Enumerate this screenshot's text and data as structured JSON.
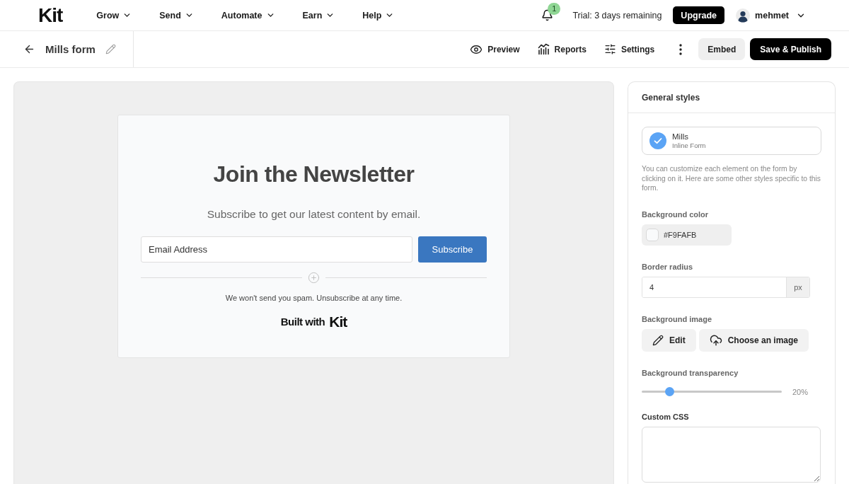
{
  "topnav": {
    "logo": "Kit",
    "menus": [
      {
        "label": "Grow"
      },
      {
        "label": "Send"
      },
      {
        "label": "Automate"
      },
      {
        "label": "Earn"
      },
      {
        "label": "Help"
      }
    ],
    "notifications": {
      "count": "1"
    },
    "trial": "Trial: 3 days remaining",
    "upgrade": "Upgrade",
    "user": {
      "name": "mehmet"
    }
  },
  "toolbar": {
    "title": "Mills form",
    "actions": [
      {
        "kind": "preview",
        "label": "Preview"
      },
      {
        "kind": "reports",
        "label": "Reports"
      },
      {
        "kind": "settings",
        "label": "Settings"
      }
    ],
    "embed": "Embed",
    "publish": "Save & Publish"
  },
  "form_preview": {
    "heading": "Join the Newsletter",
    "subheading": "Subscribe to get our latest content by email.",
    "email": {
      "placeholder": "Email Address"
    },
    "button": "Subscribe",
    "disclaimer": "We won't send you spam. Unsubscribe at any time.",
    "branding": {
      "text": "Built with",
      "logo": "Kit"
    }
  },
  "panel": {
    "title": "General styles",
    "template": {
      "name": "Mills",
      "type": "Inline Form",
      "selected": true
    },
    "help": "You can customize each element on the form by clicking on it. Here are some other styles specific to this form.",
    "background_color": {
      "label": "Background color",
      "value": "#F9FAFB"
    },
    "border_radius": {
      "label": "Border radius",
      "value": "4",
      "unit": "px"
    },
    "background_image": {
      "label": "Background image",
      "buttons": [
        {
          "kind": "edit",
          "label": "Edit"
        },
        {
          "kind": "upload",
          "label": "Choose an image"
        }
      ]
    },
    "transparency": {
      "label": "Background transparency",
      "level": 0.2,
      "reading": "20%"
    },
    "custom_css": {
      "label": "Custom CSS"
    }
  }
}
